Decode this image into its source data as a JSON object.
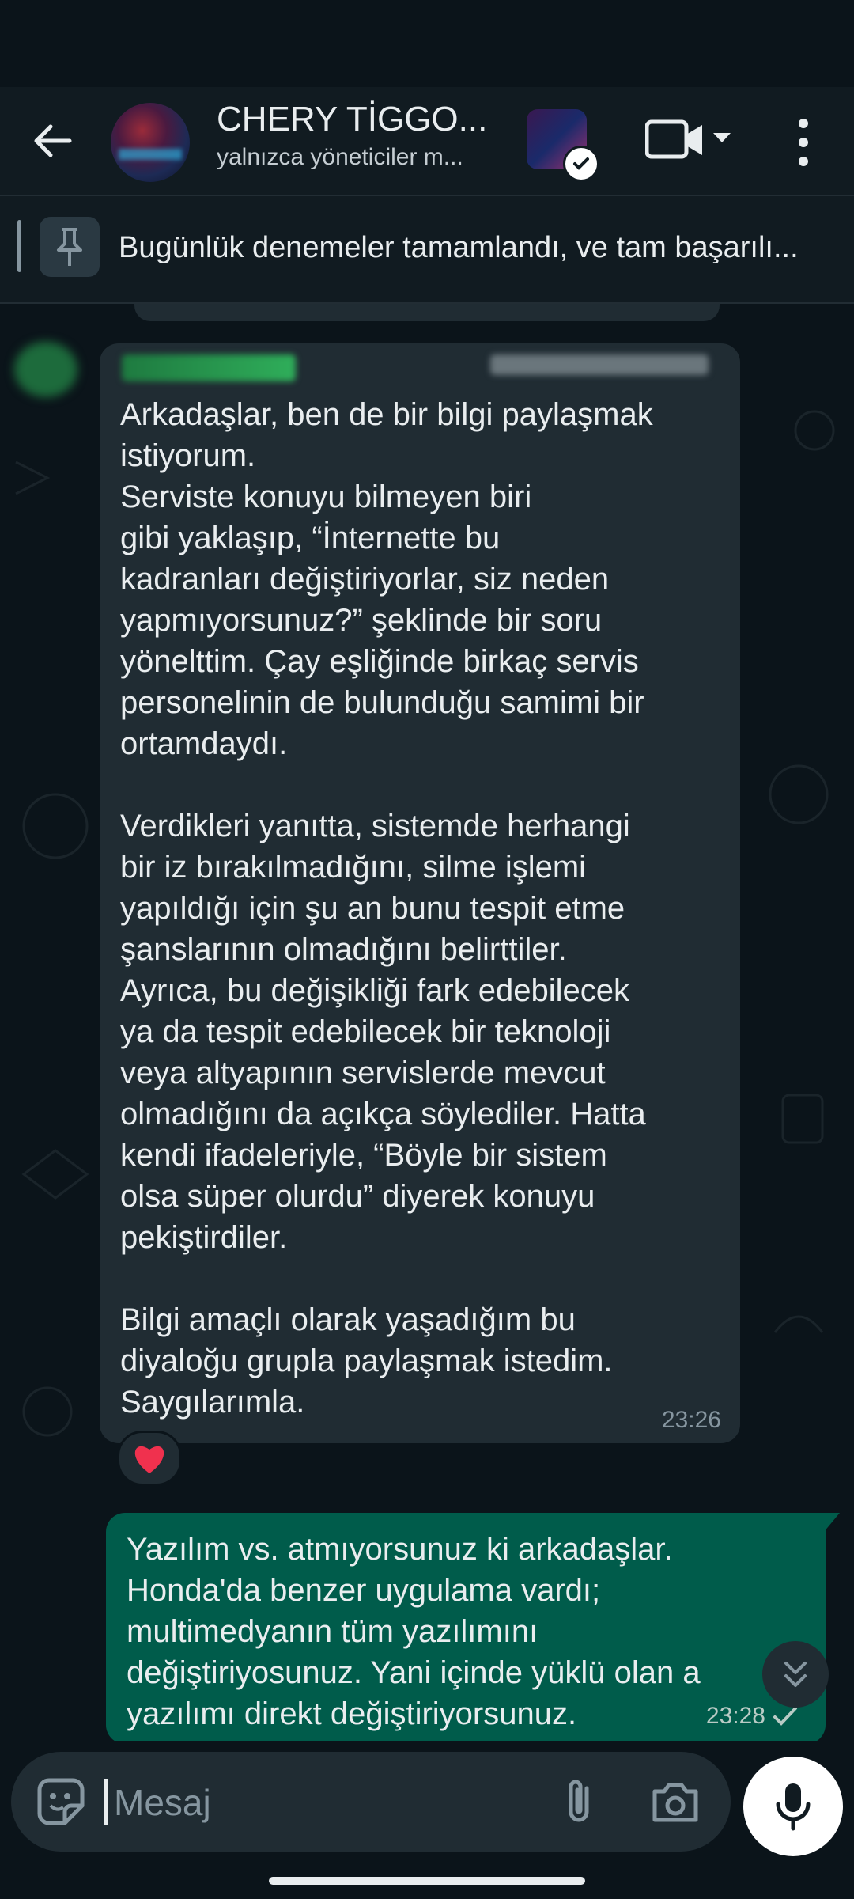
{
  "header": {
    "title": "CHERY TİGGO...",
    "subtitle": "yalnızca yöneticiler m..."
  },
  "pinned": {
    "text": "Bugünlük denemeler tamamlandı, ve tam başarılı..."
  },
  "messages": {
    "incoming": {
      "text": "Arkadaşlar, ben de bir bilgi paylaşmak\nistiyorum.\nServiste konuyu bilmeyen biri\ngibi yaklaşıp, “İnternette bu\nkadranları değiştiriyorlar, siz neden\nyapmıyorsunuz?” şeklinde bir soru\nyönelttim. Çay eşliğinde birkaç servis\npersonelinin de bulunduğu samimi bir\nortamdaydı.\n\nVerdikleri yanıtta, sistemde herhangi\nbir iz bırakılmadığını, silme işlemi\nyapıldığı için şu an bunu tespit etme\nşanslarının olmadığını belirttiler.\nAyrıca, bu değişikliği fark edebilecek\nya da tespit edebilecek bir teknoloji\nveya altyapının servislerde mevcut\nolmadığını da açıkça söylediler. Hatta\nkendi ifadeleriyle, “Böyle bir sistem\nolsa süper olurdu” diyerek konuyu\npekiştirdiler.\n\nBilgi amaçlı olarak yaşadığım bu\ndiyaloğu grupla paylaşmak istedim.\nSaygılarımla.",
      "time": "23:26",
      "reaction": "❤️"
    },
    "outgoing": {
      "text": "Yazılım vs. atmıyorsunuz ki arkadaşlar.\nHonda'da benzer uygulama vardı;\nmultimedyanın tüm yazılımını\ndeğiştiriyosunuz. Yani içinde yüklü olan a\nyazılımı direkt değiştiriyorsunuz.",
      "time": "23:28",
      "status_icon": "single-check-icon"
    }
  },
  "composer": {
    "placeholder": "Mesaj"
  },
  "icons": {
    "back": "back-arrow-icon",
    "video": "video-call-icon",
    "dropdown": "chevron-down-icon",
    "more": "more-vert-icon",
    "pin": "pin-icon",
    "scroll": "double-chevron-down-icon",
    "emoji": "sticker-icon",
    "attach": "paperclip-icon",
    "camera": "camera-icon",
    "mic": "mic-icon"
  },
  "colors": {
    "background": "#0b141a",
    "header": "#111b21",
    "incoming_bubble": "#202c33",
    "outgoing_bubble": "#005c4b",
    "text": "#e9edef",
    "muted": "#8696a0"
  }
}
